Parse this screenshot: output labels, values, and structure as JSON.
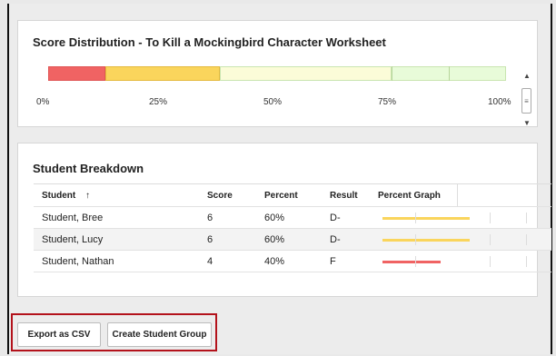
{
  "distribution": {
    "title": "Score Distribution - To Kill a Mockingbird Character Worksheet",
    "segments": [
      {
        "color": "#f06363",
        "fraction": 0.125
      },
      {
        "color": "#fad55c",
        "fraction": 0.25
      },
      {
        "color": "#fbfcd8",
        "fraction": 0.375
      },
      {
        "color": "#e8fbd9",
        "fraction": 0.25
      }
    ],
    "axis": {
      "l0": "0%",
      "l25": "25%",
      "l50": "50%",
      "l75": "75%",
      "l100": "100%"
    }
  },
  "breakdown": {
    "title": "Student Breakdown",
    "headers": {
      "student": "Student",
      "sort_arrow": "↑",
      "score": "Score",
      "percent": "Percent",
      "result": "Result",
      "graph": "Percent Graph"
    },
    "rows": [
      {
        "student": "Student, Bree",
        "score": "6",
        "percent": "60%",
        "result": "D-",
        "fill": 0.6,
        "color": "#fad55c"
      },
      {
        "student": "Student, Lucy",
        "score": "6",
        "percent": "60%",
        "result": "D-",
        "fill": 0.6,
        "color": "#fad55c"
      },
      {
        "student": "Student, Nathan",
        "score": "4",
        "percent": "40%",
        "result": "F",
        "fill": 0.4,
        "color": "#f06363"
      }
    ]
  },
  "actions": {
    "export_csv": "Export as CSV",
    "create_group": "Create Student Group"
  },
  "scroll": {
    "up": "▲",
    "grip": "≡",
    "down": "▼"
  }
}
